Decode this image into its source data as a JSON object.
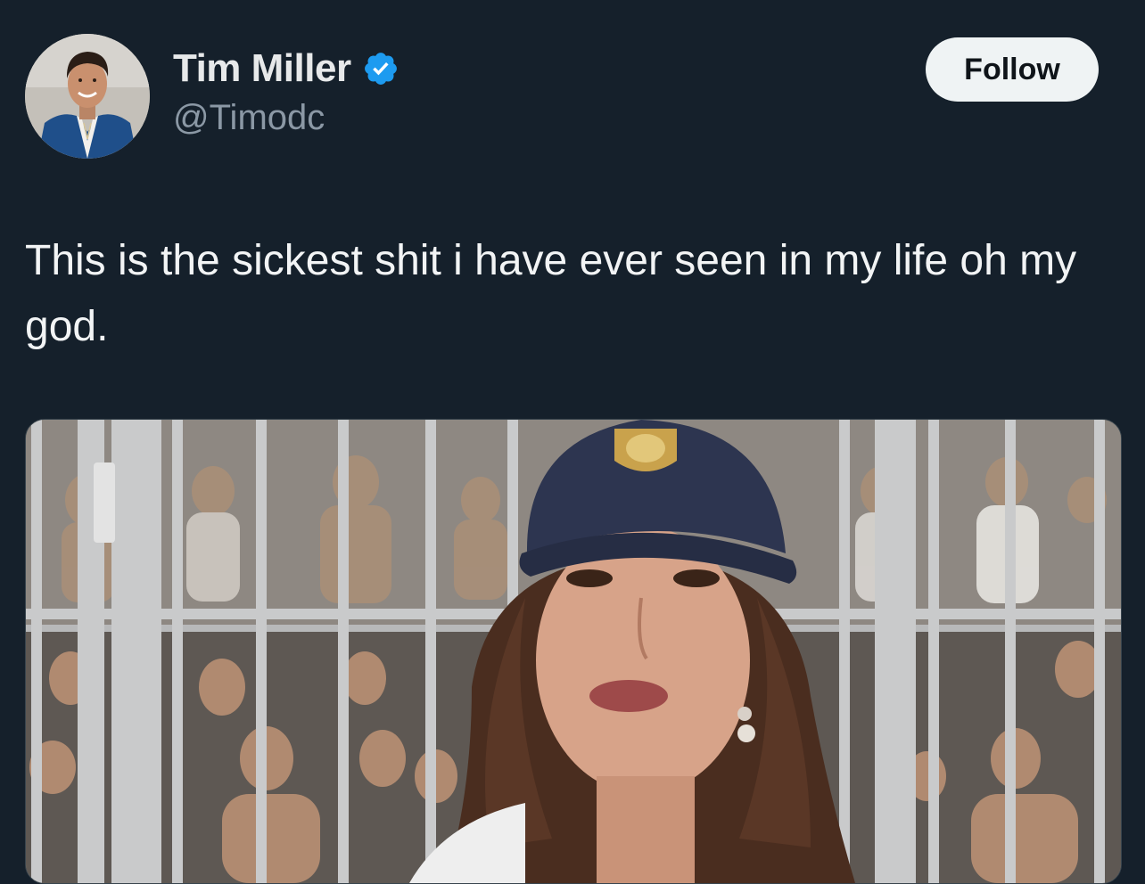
{
  "author": {
    "display_name": "Tim Miller",
    "handle": "@Timodc",
    "verified_icon": "verified-badge-icon",
    "verified_color": "#1d9bf0"
  },
  "follow_button": {
    "label": "Follow"
  },
  "tweet": {
    "text": "This is the sickest shit i have ever seen in my life oh my god."
  },
  "media": {
    "type": "video-thumbnail",
    "colors": {
      "cap": "#2d3550",
      "hair": "#4a2d1f",
      "bars": "#c9cacb"
    }
  },
  "theme": {
    "background": "#15202b",
    "text": "#e7e9ea",
    "muted": "#8b98a5"
  }
}
